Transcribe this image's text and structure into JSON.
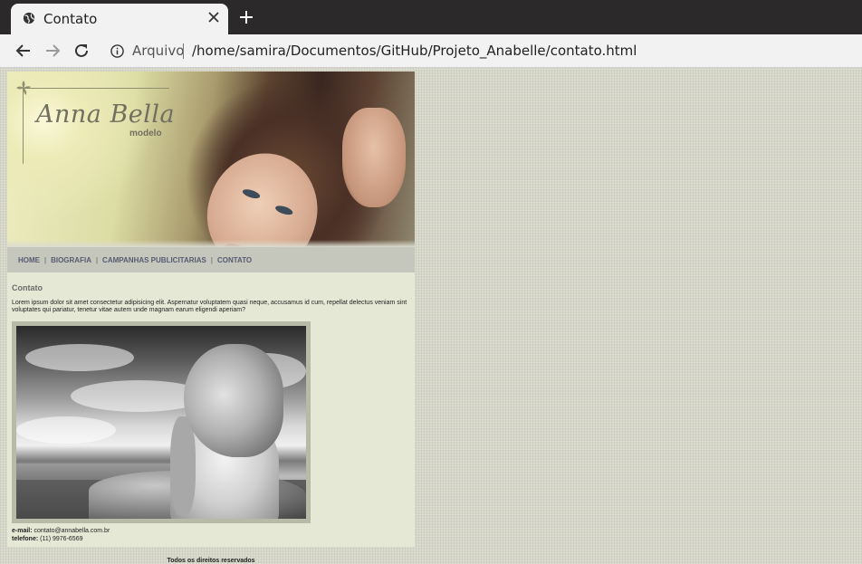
{
  "browser": {
    "tab_title": "Contato",
    "address_label": "Arquivo",
    "url": "/home/samira/Documentos/GitHub/Projeto_Anabelle/contato.html",
    "icons": {
      "tab": "globe-icon",
      "close": "close-icon",
      "new_tab": "plus-icon",
      "back": "back-arrow-icon",
      "forward": "forward-arrow-icon",
      "reload": "reload-icon",
      "info": "info-icon"
    }
  },
  "site": {
    "logo": {
      "name": "Anna Bella",
      "sub": "modelo"
    },
    "menu": [
      {
        "label": "HOME"
      },
      {
        "label": "BIOGRAFIA"
      },
      {
        "label": "CAMPANHAS PUBLICITARIAS"
      },
      {
        "label": "CONTATO"
      }
    ],
    "menu_separator": "|",
    "page_title": "Contato",
    "lead": "Lorem ipsum dolor sit amet consectetur adipisicing elit. Aspernatur voluptatem quasi neque, accusamus id cum, repellat delectus veniam sint voluptates qui pariatur, tenetur vitae autem unde magnam earum eligendi aperiam?",
    "email_label": "e-mail:",
    "email": "contato@annabella.com.br",
    "phone_label": "telefone:",
    "phone": "(11) 9976-6569",
    "footer": "Todos os direitos reservados"
  },
  "colors": {
    "tabbar": "#2b2929",
    "toolbar": "#f2f2f2",
    "page_bg": "#d6d7c8",
    "menu_bg": "#c5c6bc",
    "menu_text": "#575c72",
    "content_bg": "#e6e8d6"
  }
}
